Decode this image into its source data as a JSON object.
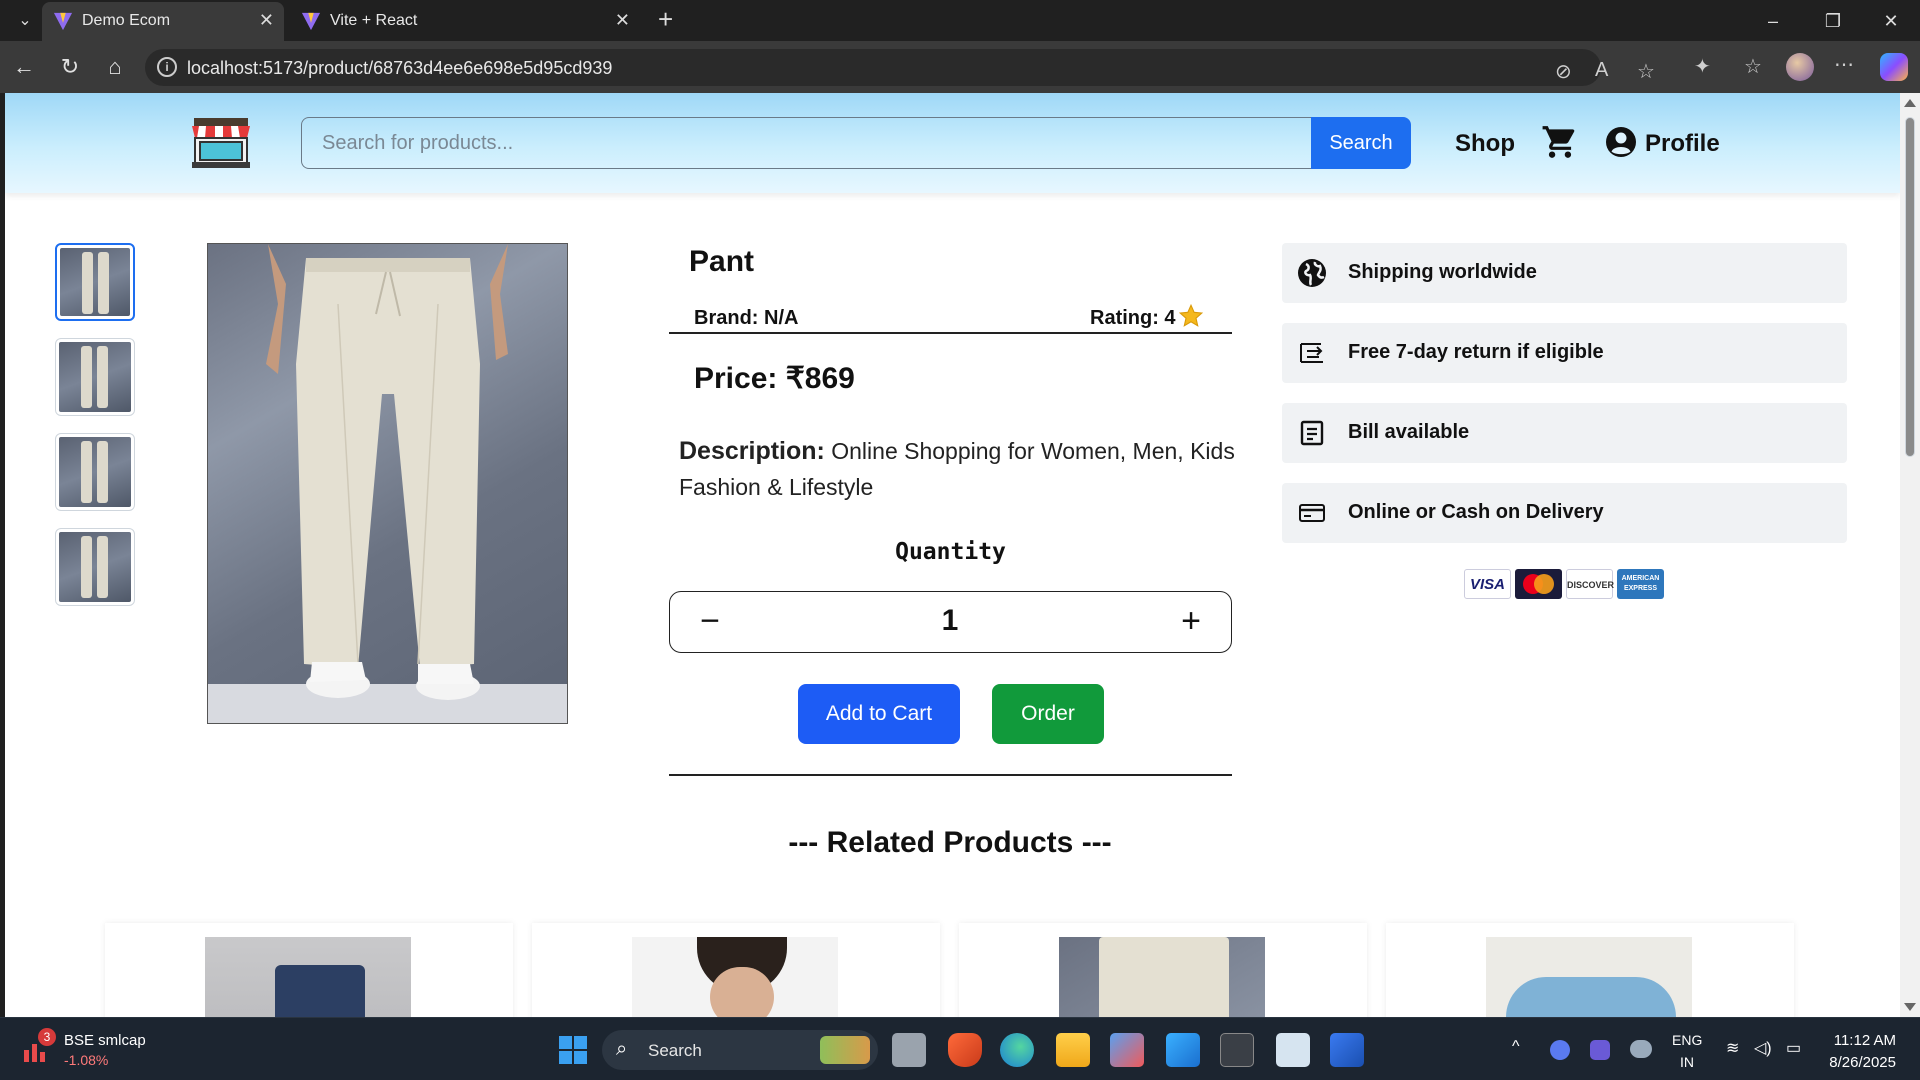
{
  "browser": {
    "tabs": [
      {
        "label": "Demo Ecom",
        "active": true
      },
      {
        "label": "Vite + React",
        "active": false
      }
    ],
    "url": "localhost:5173/product/68763d4ee6e698e5d95cd939"
  },
  "header": {
    "search_placeholder": "Search for products...",
    "search_button": "Search",
    "shop": "Shop",
    "profile": "Profile"
  },
  "product": {
    "title": "Pant",
    "brand": "Brand: N/A",
    "rating": "Rating: 4",
    "price": "Price: ₹869",
    "description_label": "Description:",
    "description": "Online Shopping for Women, Men, Kids Fashion & Lifestyle",
    "quantity_label": "Quantity",
    "quantity": "1",
    "add_to_cart": "Add to Cart",
    "order": "Order"
  },
  "features": [
    {
      "icon": "globe-icon",
      "label": "Shipping worldwide"
    },
    {
      "icon": "return-icon",
      "label": "Free 7-day return if eligible"
    },
    {
      "icon": "bill-icon",
      "label": "Bill available"
    },
    {
      "icon": "credit-card-icon",
      "label": "Online or Cash on Delivery"
    }
  ],
  "payments": [
    "VISA",
    "Mastercard",
    "DISCOVER",
    "AMERICAN EXPRESS"
  ],
  "related": {
    "title": "--- Related Products ---"
  },
  "taskbar": {
    "stock_name": "BSE smlcap",
    "stock_change": "-1.08%",
    "stock_badge": "3",
    "search": "Search",
    "lang1": "ENG",
    "lang2": "IN",
    "time": "11:12 AM",
    "date": "8/26/2025"
  },
  "colors": {
    "primary_blue": "#1d5cf5",
    "order_green": "#119a3b",
    "header_gradient_top": "#9fd8f7"
  }
}
